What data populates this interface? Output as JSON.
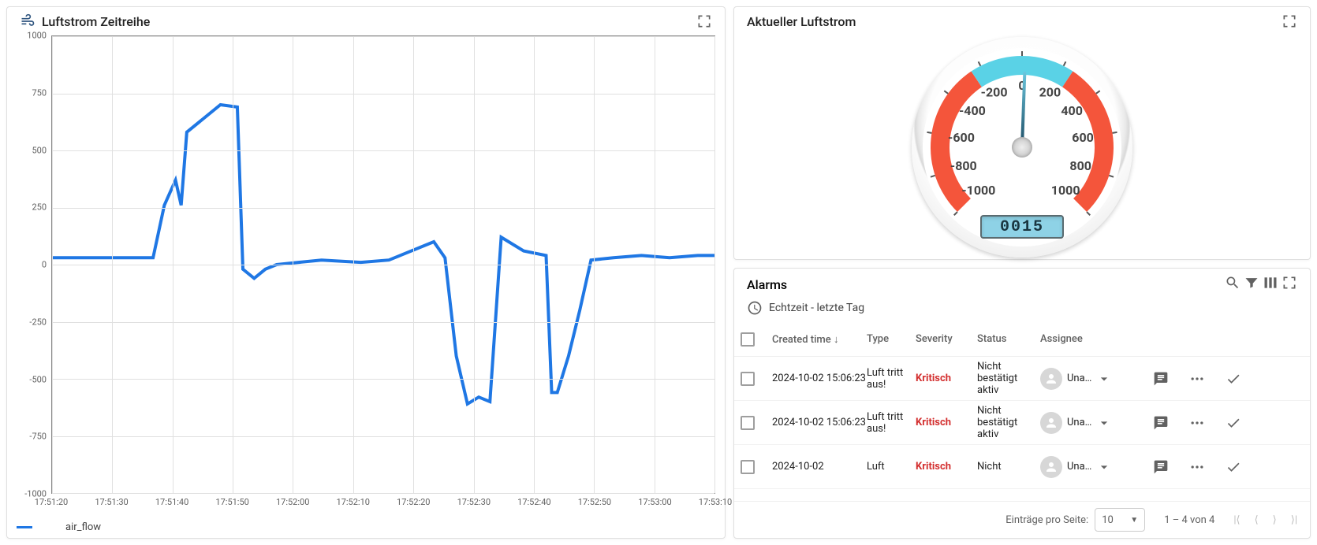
{
  "timeseries": {
    "title": "Luftstrom Zeitreihe",
    "legend_label": "air_flow"
  },
  "gauge": {
    "title": "Aktueller Luftstrom",
    "ticks": [
      "-1000",
      "-800",
      "-600",
      "-400",
      "-200",
      "0",
      "200",
      "400",
      "600",
      "800",
      "1000"
    ],
    "value": 15,
    "value_display": "0015"
  },
  "alarms": {
    "title": "Alarms",
    "subtitle": "Echtzeit - letzte Tag",
    "columns": {
      "created": "Created time",
      "type": "Type",
      "severity": "Severity",
      "status": "Status",
      "assignee": "Assignee"
    },
    "rows": [
      {
        "created": "2024-10-02 15:06:23",
        "type": "Luft tritt aus!",
        "severity": "Kritisch",
        "status": "Nicht bestätigt aktiv",
        "assignee": "Una…"
      },
      {
        "created": "2024-10-02 15:06:23",
        "type": "Luft tritt aus!",
        "severity": "Kritisch",
        "status": "Nicht bestätigt aktiv",
        "assignee": "Una…"
      },
      {
        "created": "2024-10-02",
        "type": "Luft",
        "severity": "Kritisch",
        "status": "Nicht",
        "assignee": "Una…"
      }
    ],
    "footer": {
      "per_page_label": "Einträge pro Seite:",
      "per_page_value": "10",
      "range": "1 – 4 von 4"
    }
  },
  "chart_data": {
    "type": "line",
    "title": "Luftstrom Zeitreihe",
    "xlabel": "",
    "ylabel": "",
    "ylim": [
      -1000,
      1000
    ],
    "y_ticks": [
      -1000,
      -750,
      -500,
      -250,
      0,
      250,
      500,
      750,
      1000
    ],
    "x_ticks": [
      "17:51:20",
      "17:51:30",
      "17:51:40",
      "17:51:50",
      "17:52:00",
      "17:52:10",
      "17:52:20",
      "17:52:30",
      "17:52:40",
      "17:52:50",
      "17:53:00",
      "17:53:10"
    ],
    "series": [
      {
        "name": "air_flow",
        "color": "#1f77e4",
        "x": [
          0,
          10,
          18,
          20,
          22,
          23,
          24,
          30,
          33,
          34,
          36,
          38,
          40,
          48,
          55,
          60,
          68,
          70,
          72,
          74,
          76,
          78,
          80,
          84,
          88,
          89,
          90,
          92,
          94,
          96,
          100,
          105,
          110,
          115,
          118
        ],
        "values": [
          30,
          30,
          30,
          260,
          370,
          260,
          580,
          700,
          690,
          -20,
          -60,
          -20,
          0,
          20,
          10,
          20,
          100,
          30,
          -400,
          -610,
          -580,
          -600,
          120,
          60,
          40,
          -560,
          -560,
          -400,
          -200,
          20,
          30,
          40,
          30,
          40,
          40
        ]
      }
    ]
  }
}
